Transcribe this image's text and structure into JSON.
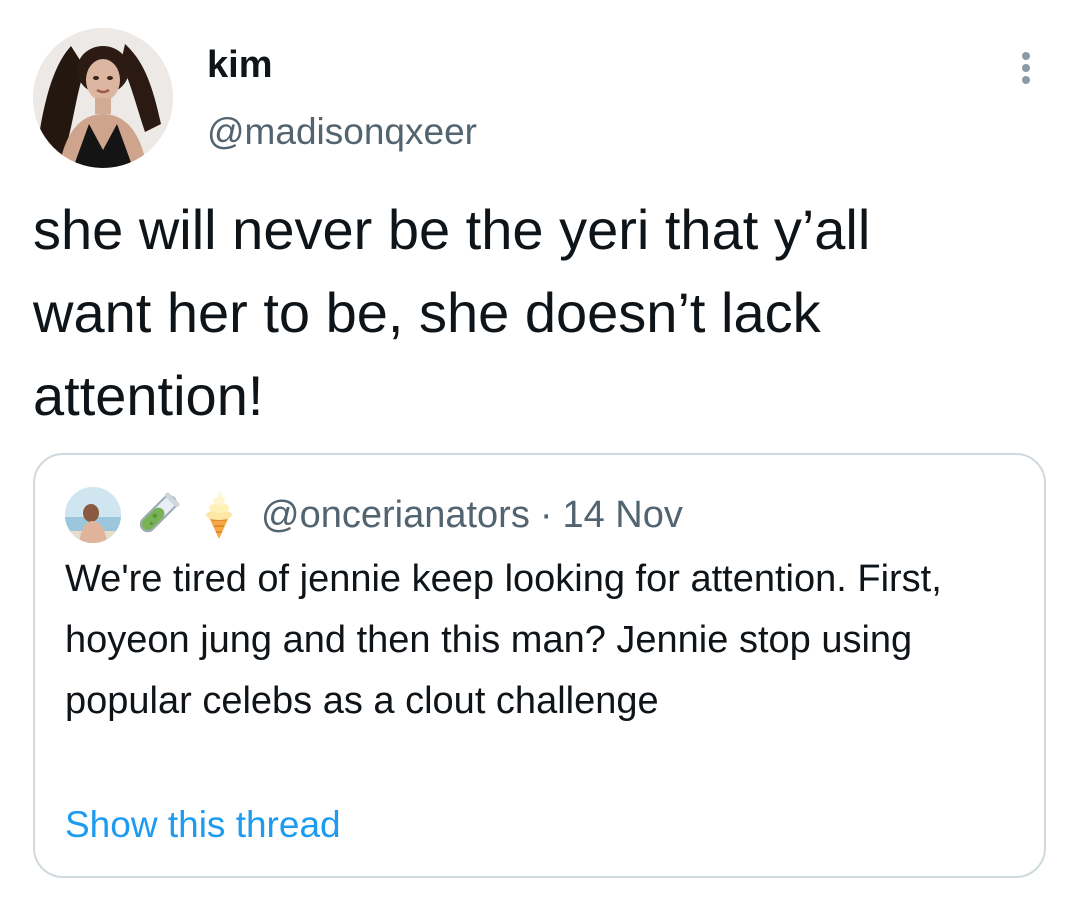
{
  "author": {
    "display_name": "kim",
    "handle": "@madisonqxeer",
    "avatar": "profile-photo"
  },
  "tweet": {
    "text": "she will never be the yeri that y’all\nwant her to be, she doesn’t lack\nattention!"
  },
  "more_icon": "more-dots-icon",
  "quoted_tweet": {
    "avatar": "profile-photo",
    "name_emojis": [
      "test-tube-emoji",
      "soft-ice-cream-emoji"
    ],
    "handle": "@oncerianators",
    "separator": "·",
    "date": "14 Nov",
    "text": "We're tired of jennie keep looking for attention. First, hoyeon jung and then this man? Jennie stop using popular celebs as a clout challenge",
    "show_thread_label": "Show this thread"
  },
  "colors": {
    "text_primary": "#0f1419",
    "text_secondary": "#536471",
    "link": "#1d9bf0",
    "border": "#cfd9de",
    "background": "#ffffff"
  }
}
